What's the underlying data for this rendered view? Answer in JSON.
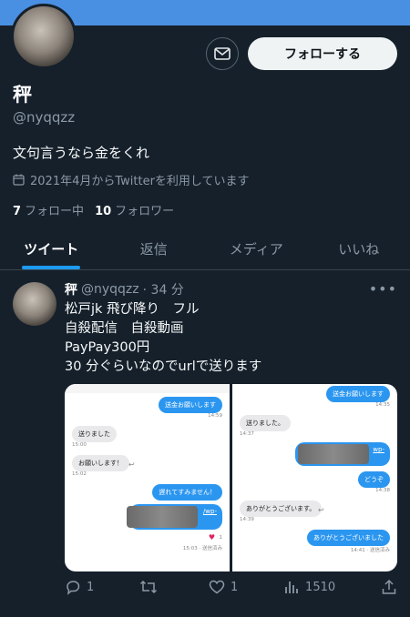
{
  "profile": {
    "name": "秤",
    "handle": "@nyqqzz",
    "bio": "文句言うなら金をくれ",
    "joined": "2021年4月からTwitterを利用しています",
    "following_count": "7",
    "following_label": "フォロー中",
    "followers_count": "10",
    "followers_label": "フォロワー",
    "follow_button": "フォローする"
  },
  "tabs": [
    {
      "label": "ツイート",
      "active": true
    },
    {
      "label": "返信"
    },
    {
      "label": "メディア"
    },
    {
      "label": "いいね"
    }
  ],
  "tweet": {
    "name": "秤",
    "handle": "@nyqqzz",
    "time": "· 34 分",
    "lines": [
      "松戸jk 飛び降り　フル",
      "自殺配信　自殺動画",
      "PayPay300円",
      "30 分ぐらいなのでurlで送ります"
    ],
    "replies": "1",
    "retweets": "",
    "likes": "1",
    "views": "1510"
  },
  "left_shot": {
    "msg1": "送金お願いします",
    "ts1": "14:59",
    "msg2": "送りました",
    "ts2": "15:00",
    "msg3": "お願いします！",
    "ts3": "15:02",
    "msg4": "遅れてすみません！",
    "link": "/wp-",
    "ts5": "15:03 · 送信済み",
    "like_count": "1"
  },
  "right_shot": {
    "msg1": "送金お願いします",
    "ts1": "14:35",
    "msg2": "送りました。",
    "ts2": "14:37",
    "link": "wp-",
    "msg3": "どうぞ",
    "ts3": "14:38",
    "msg4": "ありがとうございます。",
    "ts4": "14:39",
    "msg5": "ありがとうございました",
    "ts5": "14:41 · 送信済み"
  }
}
